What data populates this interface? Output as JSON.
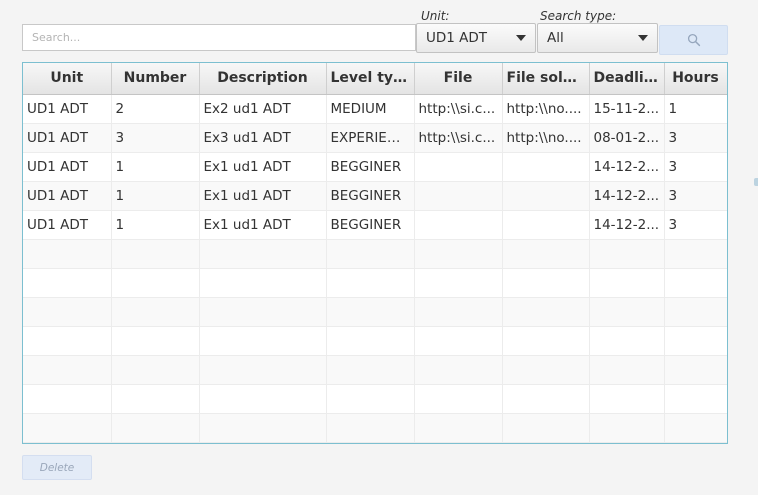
{
  "search": {
    "placeholder": "Search...",
    "value": "",
    "button_icon": "search-icon"
  },
  "filters": {
    "unit": {
      "label": "Unit:",
      "selected": "UD1 ADT"
    },
    "search_type": {
      "label": "Search type:",
      "selected": "All"
    }
  },
  "table": {
    "columns": [
      "Unit",
      "Number",
      "Description",
      "Level type",
      "File",
      "File solut...",
      "Deadline",
      "Hours"
    ],
    "rows": [
      [
        "UD1 ADT",
        "2",
        "Ex2 ud1 ADT",
        "MEDIUM",
        "http:\\\\si.c...",
        "http:\\\\no....",
        "15-11-2...",
        "1"
      ],
      [
        "UD1 ADT",
        "3",
        "Ex3 ud1 ADT",
        "EXPERIEN...",
        "http:\\\\si.c...",
        "http:\\\\no....",
        "08-01-2...",
        "3"
      ],
      [
        "UD1 ADT",
        "1",
        "Ex1 ud1 ADT",
        "BEGGINER",
        "",
        "",
        "14-12-2...",
        "3"
      ],
      [
        "UD1 ADT",
        "1",
        "Ex1 ud1 ADT",
        "BEGGINER",
        "",
        "",
        "14-12-2...",
        "3"
      ],
      [
        "UD1 ADT",
        "1",
        "Ex1 ud1 ADT",
        "BEGGINER",
        "",
        "",
        "14-12-2...",
        "3"
      ]
    ],
    "empty_rows": 7
  },
  "actions": {
    "delete_label": "Delete"
  },
  "colors": {
    "table_border": "#7cbfd0",
    "search_button_bg": "#dde8f7",
    "delete_button_bg": "#e3ebf7"
  }
}
